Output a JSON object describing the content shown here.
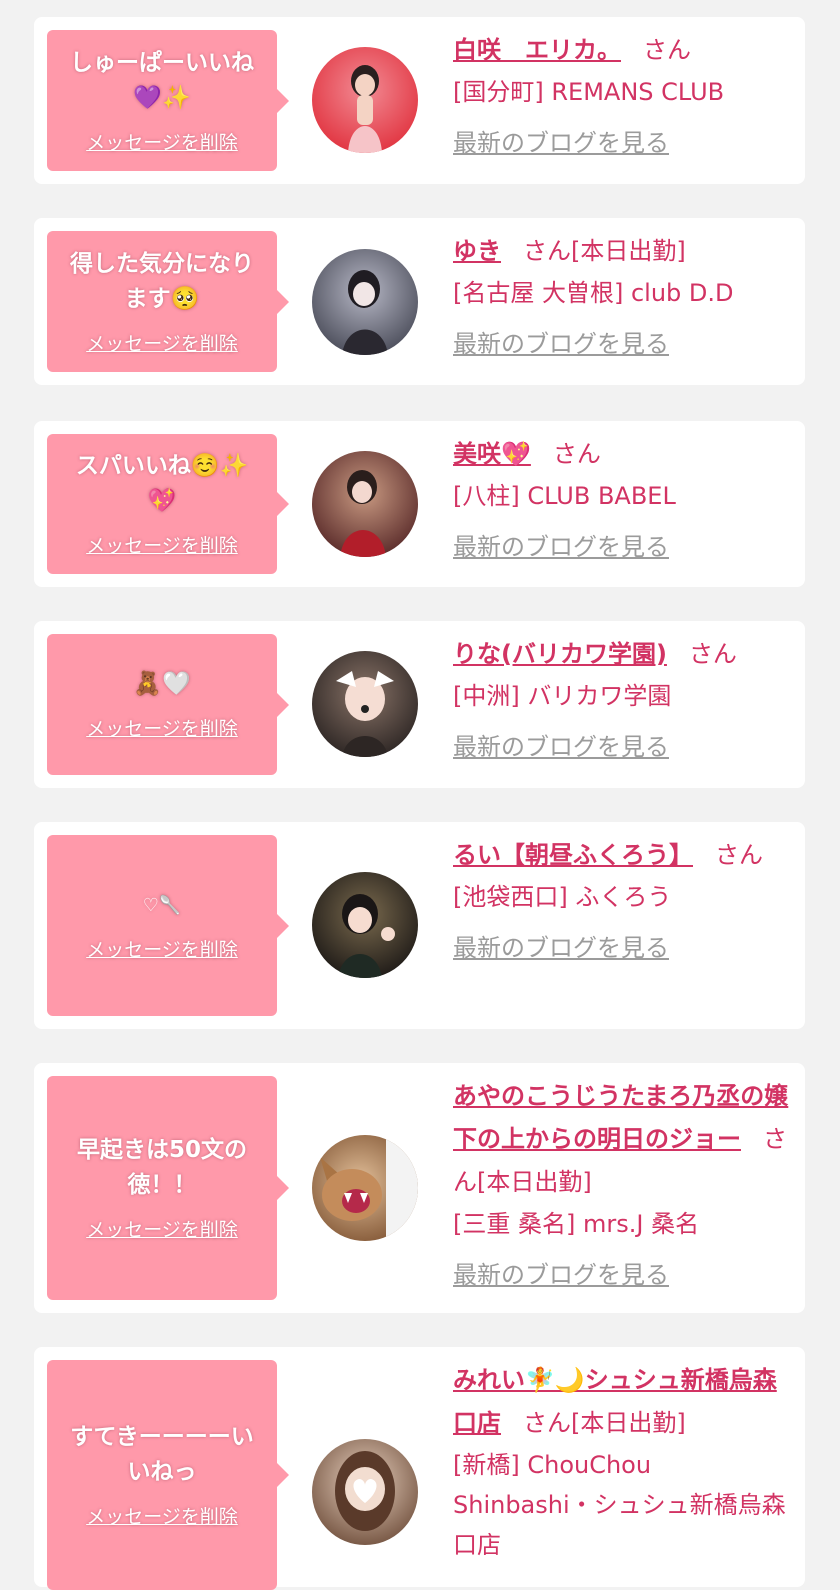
{
  "delete_label": "メッセージを削除",
  "blog_label": "最新のブログを見る",
  "honorific": "さん",
  "items": [
    {
      "message": "しゅーぱーいいね\n💜✨",
      "name": "白咲　エリカ。",
      "tag": "",
      "shop": "[国分町] REMANS CLUB",
      "avatar_colors": [
        "#f05a6a",
        "#e23945"
      ]
    },
    {
      "message": "得した気分になり\nます🥺",
      "name": "ゆき",
      "tag": "[本日出勤]",
      "shop": "[名古屋 大曽根] club D.D",
      "avatar_colors": [
        "#8e8fa0",
        "#4b4d5a"
      ]
    },
    {
      "message": "スパいいね☺️✨\n💖",
      "name": "美咲💖",
      "tag": "",
      "shop": "[八柱] CLUB BABEL",
      "avatar_colors": [
        "#b3675a",
        "#5a2b2a"
      ]
    },
    {
      "message": "🧸🤍",
      "name": "りな(バリカワ学園)",
      "tag": "",
      "shop": "[中洲] バリカワ学園",
      "avatar_colors": [
        "#6e5a50",
        "#2d2624"
      ]
    },
    {
      "message": "♡🥄",
      "name": "るい【朝昼ふくろう】",
      "tag": "",
      "shop": "[池袋西口] ふくろう",
      "avatar_colors": [
        "#4a3a2e",
        "#1e1a17"
      ]
    },
    {
      "message": "早起きは50文の\n徳！！",
      "name": "あやのこうじうたまろ乃丞の嬢下の上からの明日のジョー",
      "tag": "[本日出勤]",
      "shop": "[三重 桑名] mrs.J 桑名",
      "avatar_colors": [
        "#c99a6e",
        "#7a4e2d"
      ]
    },
    {
      "message": "すてきーーーーい\nいねっ",
      "name": "みれい🧚🌙シュシュ新橋烏森口店",
      "tag": "[本日出勤]",
      "shop": "[新橋] ChouChou Shinbashi・シュシュ新橋烏森口店",
      "avatar_colors": [
        "#c9a68a",
        "#6e4d3a"
      ]
    }
  ]
}
